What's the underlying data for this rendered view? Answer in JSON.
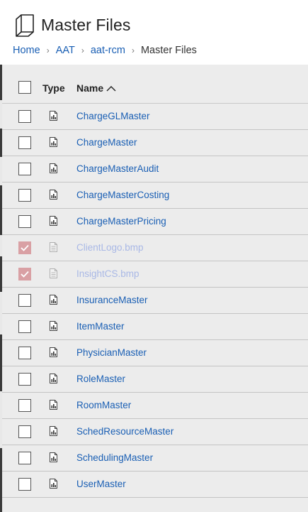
{
  "header": {
    "title": "Master Files",
    "title_icon": "folder-outline-icon",
    "breadcrumb": [
      {
        "label": "Home",
        "link": true
      },
      {
        "label": "AAT",
        "link": true
      },
      {
        "label": "aat-rcm",
        "link": true
      },
      {
        "label": "Master Files",
        "link": false
      }
    ],
    "separator": "›"
  },
  "list": {
    "columns": {
      "type": "Type",
      "name": "Name",
      "sort": "ascending"
    },
    "items": [
      {
        "name": "ChargeGLMaster",
        "type_icon": "spreadsheet-file-icon",
        "checked": false
      },
      {
        "name": "ChargeMaster",
        "type_icon": "spreadsheet-file-icon",
        "checked": false
      },
      {
        "name": "ChargeMasterAudit",
        "type_icon": "spreadsheet-file-icon",
        "checked": false
      },
      {
        "name": "ChargeMasterCosting",
        "type_icon": "spreadsheet-file-icon",
        "checked": false
      },
      {
        "name": "ChargeMasterPricing",
        "type_icon": "spreadsheet-file-icon",
        "checked": false
      },
      {
        "name": "ClientLogo.bmp",
        "type_icon": "document-file-icon",
        "checked": true
      },
      {
        "name": "InsightCS.bmp",
        "type_icon": "document-file-icon",
        "checked": true
      },
      {
        "name": "InsuranceMaster",
        "type_icon": "spreadsheet-file-icon",
        "checked": false
      },
      {
        "name": "ItemMaster",
        "type_icon": "spreadsheet-file-icon",
        "checked": false
      },
      {
        "name": "PhysicianMaster",
        "type_icon": "spreadsheet-file-icon",
        "checked": false
      },
      {
        "name": "RoleMaster",
        "type_icon": "spreadsheet-file-icon",
        "checked": false
      },
      {
        "name": "RoomMaster",
        "type_icon": "spreadsheet-file-icon",
        "checked": false
      },
      {
        "name": "SchedResourceMaster",
        "type_icon": "spreadsheet-file-icon",
        "checked": false
      },
      {
        "name": "SchedulingMaster",
        "type_icon": "spreadsheet-file-icon",
        "checked": false
      },
      {
        "name": "UserMaster",
        "type_icon": "spreadsheet-file-icon",
        "checked": false
      }
    ]
  },
  "colors": {
    "link": "#1a5fb4",
    "checked_fill": "#d9a0a4",
    "list_bg": "#ececec"
  }
}
